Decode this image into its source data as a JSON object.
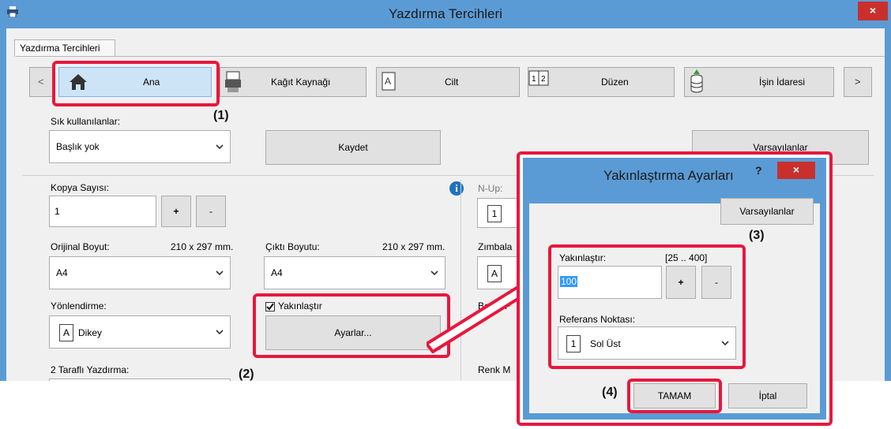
{
  "window": {
    "title": "Yazdırma Tercihleri",
    "close": "×"
  },
  "tab": {
    "label": "Yazdırma Tercihleri"
  },
  "nav": {
    "prev": "<",
    "next": ">",
    "tabs": [
      {
        "label": "Ana",
        "icon": "home-icon"
      },
      {
        "label": "Kağıt Kaynağı",
        "icon": "paper-tray-icon"
      },
      {
        "label": "Cilt",
        "icon": "binding-icon"
      },
      {
        "label": "Düzen",
        "icon": "layout-icon"
      },
      {
        "label": "İşin İdaresi",
        "icon": "job-handling-icon"
      }
    ]
  },
  "favorites": {
    "label": "Sık kullanılanlar:",
    "value": "Başlık yok",
    "save": "Kaydet",
    "defaults": "Varsayılanlar"
  },
  "copies": {
    "label": "Kopya Sayısı:",
    "value": "1",
    "plus": "+",
    "minus": "-"
  },
  "original_size": {
    "label": "Orijinal Boyut:",
    "dims": "210 x 297 mm.",
    "value": "A4"
  },
  "output_size": {
    "label": "Çıktı Boyutu:",
    "dims": "210 x 297 mm.",
    "value": "A4"
  },
  "orientation": {
    "label": "Yönlendirme:",
    "value": "Dikey",
    "icon_letter": "A"
  },
  "zoom_checkbox": {
    "label": "Yakınlaştır",
    "checked": true
  },
  "settings_button": "Ayarlar...",
  "duplex": {
    "label": "2 Taraflı Yazdırma:"
  },
  "right_col": {
    "nup": "N-Up:",
    "nup_val": "1",
    "staple": "Zımbala",
    "staple_val": "A",
    "doc": "Belge F",
    "color": "Renk M"
  },
  "dialog": {
    "title": "Yakınlaştırma Ayarları",
    "help": "?",
    "close": "×",
    "defaults": "Varsayılanlar",
    "zoom_label": "Yakınlaştır:",
    "zoom_range": "[25 .. 400]",
    "zoom_value": "100",
    "plus": "+",
    "minus": "-",
    "ref_label": "Referans Noktası:",
    "ref_value": "Sol Üst",
    "ref_icon_num": "1",
    "ok": "TAMAM",
    "cancel": "İptal"
  },
  "callouts": {
    "c1": "(1)",
    "c2": "(2)",
    "c3": "(3)",
    "c4": "(4)"
  },
  "colors": {
    "titlebar": "#5b9bd5",
    "highlight": "#e8173d",
    "close": "#c9302c"
  }
}
